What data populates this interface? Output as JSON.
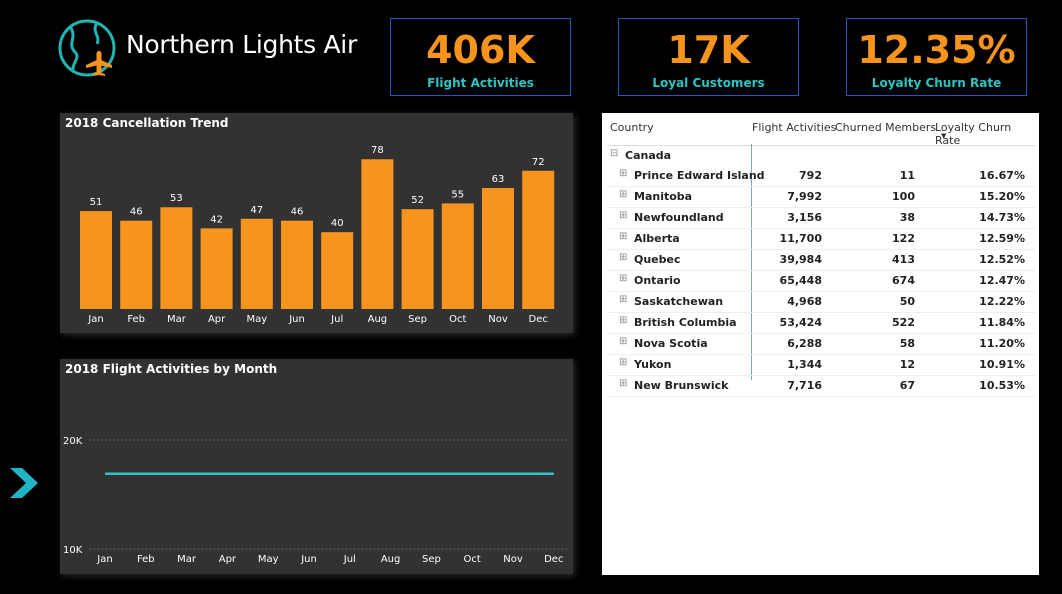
{
  "brand": {
    "name": "Northern Lights Air"
  },
  "kpis": [
    {
      "value": "406K",
      "label": "Flight Activities"
    },
    {
      "value": "17K",
      "label": "Loyal Customers"
    },
    {
      "value": "12.35%",
      "label": "Loyalty Churn Rate"
    }
  ],
  "colors": {
    "accent_orange": "#f7941d",
    "accent_teal": "#2ec4c4",
    "panel_bg": "#323232",
    "kpi_border": "#2a55b8"
  },
  "chart_data": [
    {
      "type": "bar",
      "title": "2018 Cancellation Trend",
      "categories": [
        "Jan",
        "Feb",
        "Mar",
        "Apr",
        "May",
        "Jun",
        "Jul",
        "Aug",
        "Sep",
        "Oct",
        "Nov",
        "Dec"
      ],
      "values": [
        51,
        46,
        53,
        42,
        47,
        46,
        40,
        78,
        52,
        55,
        63,
        72
      ],
      "ylim": [
        0,
        80
      ],
      "grid": false,
      "data_labels": true
    },
    {
      "type": "line",
      "title": "2018 Flight Activities by Month",
      "categories": [
        "Jan",
        "Feb",
        "Mar",
        "Apr",
        "May",
        "Jun",
        "Jul",
        "Aug",
        "Sep",
        "Oct",
        "Nov",
        "Dec"
      ],
      "values": [
        16900,
        16900,
        16900,
        16900,
        16900,
        16900,
        16900,
        16900,
        16900,
        16900,
        16900,
        16900
      ],
      "ylim": [
        10000,
        21000
      ],
      "yticks": [
        {
          "value": 20000,
          "label": "20K"
        },
        {
          "value": 10000,
          "label": "10K"
        }
      ],
      "grid": true
    }
  ],
  "table": {
    "headers": [
      "Country",
      "Flight Activities",
      "Churned Members",
      "Loyalty Churn Rate"
    ],
    "group": "Canada",
    "group_icon": "minus-box-icon",
    "row_icon": "plus-box-icon",
    "rows": [
      [
        "Prince Edward Island",
        "792",
        "11",
        "16.67%"
      ],
      [
        "Manitoba",
        "7,992",
        "100",
        "15.20%"
      ],
      [
        "Newfoundland",
        "3,156",
        "38",
        "14.73%"
      ],
      [
        "Alberta",
        "11,700",
        "122",
        "12.59%"
      ],
      [
        "Quebec",
        "39,984",
        "413",
        "12.52%"
      ],
      [
        "Ontario",
        "65,448",
        "674",
        "12.47%"
      ],
      [
        "Saskatchewan",
        "4,968",
        "50",
        "12.22%"
      ],
      [
        "British Columbia",
        "53,424",
        "522",
        "11.84%"
      ],
      [
        "Nova Scotia",
        "6,288",
        "58",
        "11.20%"
      ],
      [
        "Yukon",
        "1,344",
        "12",
        "10.91%"
      ],
      [
        "New Brunswick",
        "7,716",
        "67",
        "10.53%"
      ]
    ]
  }
}
